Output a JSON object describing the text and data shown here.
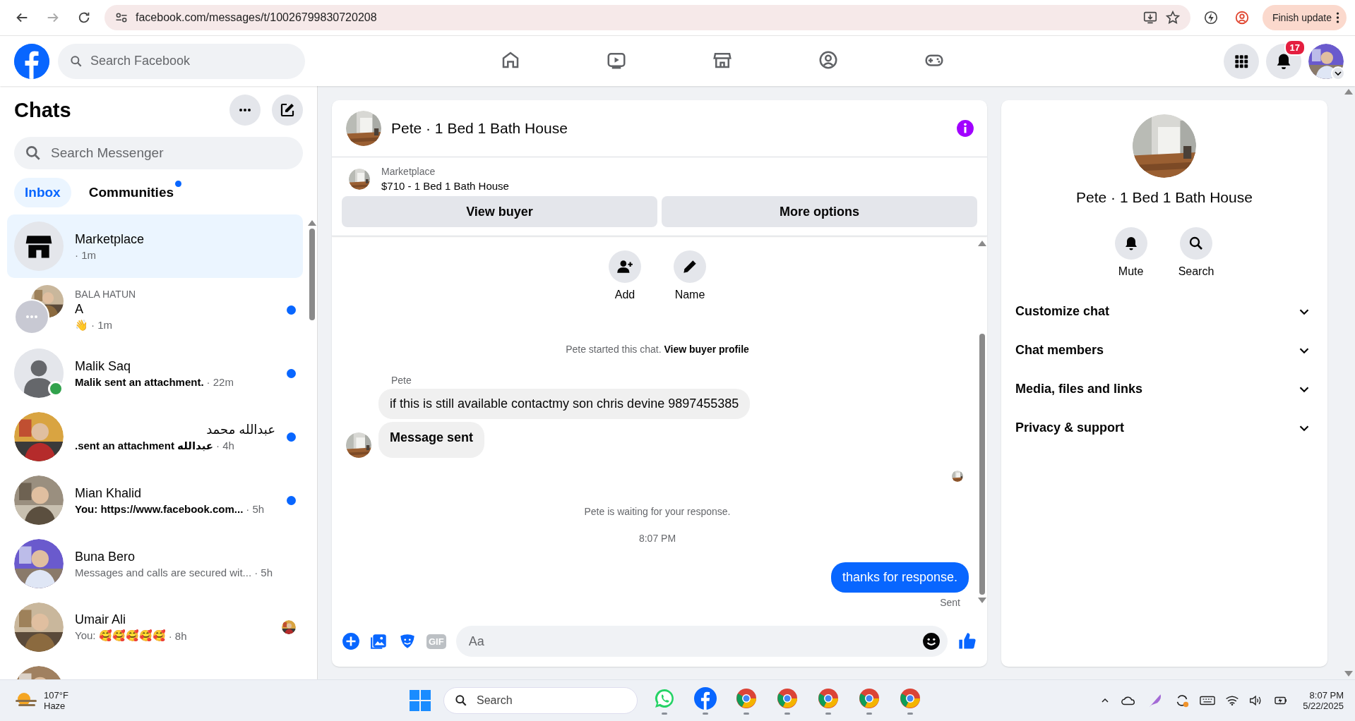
{
  "browser": {
    "url": "facebook.com/messages/t/10026799830720208",
    "update_button": "Finish update"
  },
  "header": {
    "search": {
      "placeholder": "Search Facebook"
    },
    "nav": [
      {
        "kind": "home",
        "selected": false
      },
      {
        "kind": "video",
        "selected": false
      },
      {
        "kind": "marketplace",
        "selected": false
      },
      {
        "kind": "groups",
        "selected": false
      },
      {
        "kind": "gaming",
        "selected": false
      }
    ],
    "notification_count": "17"
  },
  "sidebar": {
    "title": "Chats",
    "search": {
      "placeholder": "Search Messenger"
    },
    "tabs": [
      {
        "label": "Inbox",
        "selected": true,
        "badge": false
      },
      {
        "label": "Communities",
        "selected": false,
        "badge": true
      }
    ],
    "chats": [
      {
        "kind": "store",
        "name": "Marketplace",
        "time": "· 1m",
        "unread": false,
        "selected": true,
        "online": false,
        "seen": false
      },
      {
        "kind": "group",
        "group": "BALA HATUN",
        "name": "A",
        "preview": "👋",
        "time": "· 1m",
        "unread": true,
        "selected": false,
        "online": false,
        "seen": false
      },
      {
        "kind": "silhouette",
        "name": "Malik Saq",
        "preview": "Malik sent an attachment.",
        "time": "· 22m",
        "unread": true,
        "selected": false,
        "online": true,
        "seen": false
      },
      {
        "kind": "picture",
        "name": "عبدالله محمد",
        "preview": "عبدالله sent an attachment.",
        "time": "· 4h",
        "unread": true,
        "selected": false,
        "online": false,
        "seen": false
      },
      {
        "kind": "picture",
        "name": "Mian Khalid",
        "preview": "You: https://www.facebook.com...",
        "time": "· 5h",
        "unread": true,
        "selected": false,
        "online": false,
        "seen": false
      },
      {
        "kind": "picture",
        "name": "Buna Bero",
        "preview": "Messages and calls are secured wit...",
        "time": "· 5h",
        "unread": false,
        "selected": false,
        "online": false,
        "seen": false
      },
      {
        "kind": "picture",
        "name": "Umair Ali",
        "preview": "You: 🥰🥰🥰🥰🥰",
        "time": "· 8h",
        "unread": false,
        "selected": false,
        "online": false,
        "seen": true
      },
      {
        "kind": "picture",
        "selected": false,
        "unread": false,
        "online": false,
        "seen": false
      }
    ]
  },
  "conversation": {
    "title": "Pete · 1 Bed 1 Bath House",
    "listing": {
      "source": "Marketplace",
      "title": "$710 - 1 Bed 1 Bath House"
    },
    "buttons": [
      "View buyer",
      "More options"
    ],
    "actions": [
      {
        "kind": "add",
        "label": "Add"
      },
      {
        "kind": "name",
        "label": "Name"
      }
    ],
    "messages": [
      {
        "kind": "system",
        "text": "Pete started this chat.",
        "link": "View buyer profile"
      },
      {
        "kind": "sender",
        "text": "Pete"
      },
      {
        "kind": "incoming",
        "text": "if this is still available contactmy son chris devine 9897455385",
        "bold": false,
        "avatar": false
      },
      {
        "kind": "incoming",
        "text": "Message sent",
        "bold": true,
        "avatar": true
      },
      {
        "kind": "seen"
      },
      {
        "kind": "system",
        "text": "Pete is waiting for your response."
      },
      {
        "kind": "time",
        "text": "8:07 PM"
      },
      {
        "kind": "outgoing",
        "text": "thanks for response."
      },
      {
        "kind": "status",
        "text": "Sent"
      }
    ],
    "composer": {
      "placeholder": "Aa",
      "gif_label": "GIF"
    }
  },
  "details": {
    "title": "Pete · 1 Bed 1 Bath House",
    "actions": [
      {
        "kind": "mute",
        "label": "Mute"
      },
      {
        "kind": "search",
        "label": "Search"
      }
    ],
    "sections": [
      {
        "label": "Customize chat",
        "expanded": false
      },
      {
        "label": "Chat members",
        "expanded": false
      },
      {
        "label": "Media, files and links",
        "expanded": false
      },
      {
        "label": "Privacy & support",
        "expanded": false
      }
    ]
  },
  "taskbar": {
    "weather": {
      "temperature": "107°F",
      "condition": "Haze"
    },
    "search": {
      "placeholder": "Search"
    },
    "apps": [
      {
        "kind": "whatsapp"
      },
      {
        "kind": "facebook"
      },
      {
        "kind": "chrome"
      },
      {
        "kind": "chrome"
      },
      {
        "kind": "chrome"
      },
      {
        "kind": "chrome"
      },
      {
        "kind": "chrome"
      }
    ],
    "clock": {
      "time": "8:07 PM",
      "date": "5/22/2025"
    }
  }
}
